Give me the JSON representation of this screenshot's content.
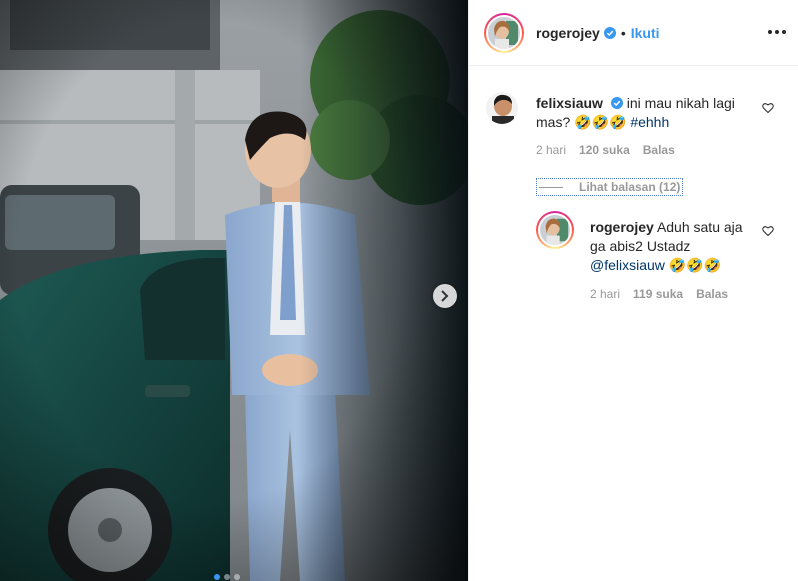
{
  "post": {
    "username": "rogerojey",
    "separator": "•",
    "follow_label": "Ikuti",
    "more_icon": "more-options-icon",
    "carousel": {
      "dots": 3,
      "active_index": 0,
      "next_icon": "chevron-right-icon"
    }
  },
  "comments": [
    {
      "username": "felixsiauw",
      "verified": true,
      "text_line1": "ini mau nikah lagi",
      "text_line2": "mas?",
      "emojis": "🤣🤣🤣",
      "hashtag": "#ehhh",
      "time": "2 hari",
      "likes": "120 suka",
      "reply_label": "Balas",
      "view_replies": "Lihat balasan (12)"
    }
  ],
  "replies": [
    {
      "username": "rogerojey",
      "verified": false,
      "text_line1": "Aduh satu aja",
      "text_line2": "ga abis2 Ustadz",
      "mention": "@felixsiauw",
      "emojis": "🤣🤣🤣",
      "time": "2 hari",
      "likes": "119 suka",
      "reply_label": "Balas"
    }
  ],
  "colors": {
    "link_blue": "#3897f0",
    "text": "#262626",
    "muted": "#999999",
    "verified_blue": "#3897f0"
  }
}
